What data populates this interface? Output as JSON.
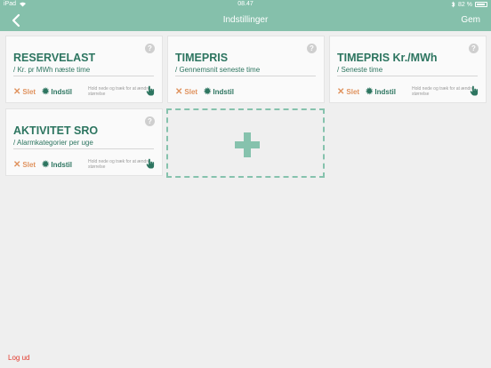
{
  "status_bar": {
    "device": "iPad",
    "time": "08.47",
    "battery": "82 %"
  },
  "nav": {
    "title": "Indstillinger",
    "save_label": "Gem",
    "back_icon": "chevron-left-icon"
  },
  "cards": [
    {
      "title": "RESERVELAST",
      "subtitle": "/ Kr. pr MWh næste time",
      "help": "?",
      "delete_label": "Slet",
      "setup_label": "Indstil",
      "hint": "Hold nede og træk for at ændre størrelse"
    },
    {
      "title": "TIMEPRIS",
      "subtitle": "/ Gennemsnit seneste time",
      "help": "?",
      "delete_label": "Slet",
      "setup_label": "Indstil",
      "hint": "Hold nede og træk for at ændre størrelse"
    },
    {
      "title": "TIMEPRIS Kr./MWh",
      "subtitle": "/ Seneste time",
      "help": "?",
      "delete_label": "Slet",
      "setup_label": "Indstil",
      "hint": "Hold nede og træk for at ændre størrelse"
    },
    {
      "title": "AKTIVITET SRO",
      "subtitle": "/ Alarmkategorier per uge",
      "help": "?",
      "delete_label": "Slet",
      "setup_label": "Indstil",
      "hint": "Hold nede og træk for at ændre størrelse"
    }
  ],
  "add_card": {
    "icon": "plus-icon"
  },
  "footer": {
    "logout_label": "Log ud"
  },
  "colors": {
    "header": "#85c0ab",
    "title_text": "#2d7560",
    "delete": "#e0935f",
    "logout": "#e23a2d"
  }
}
